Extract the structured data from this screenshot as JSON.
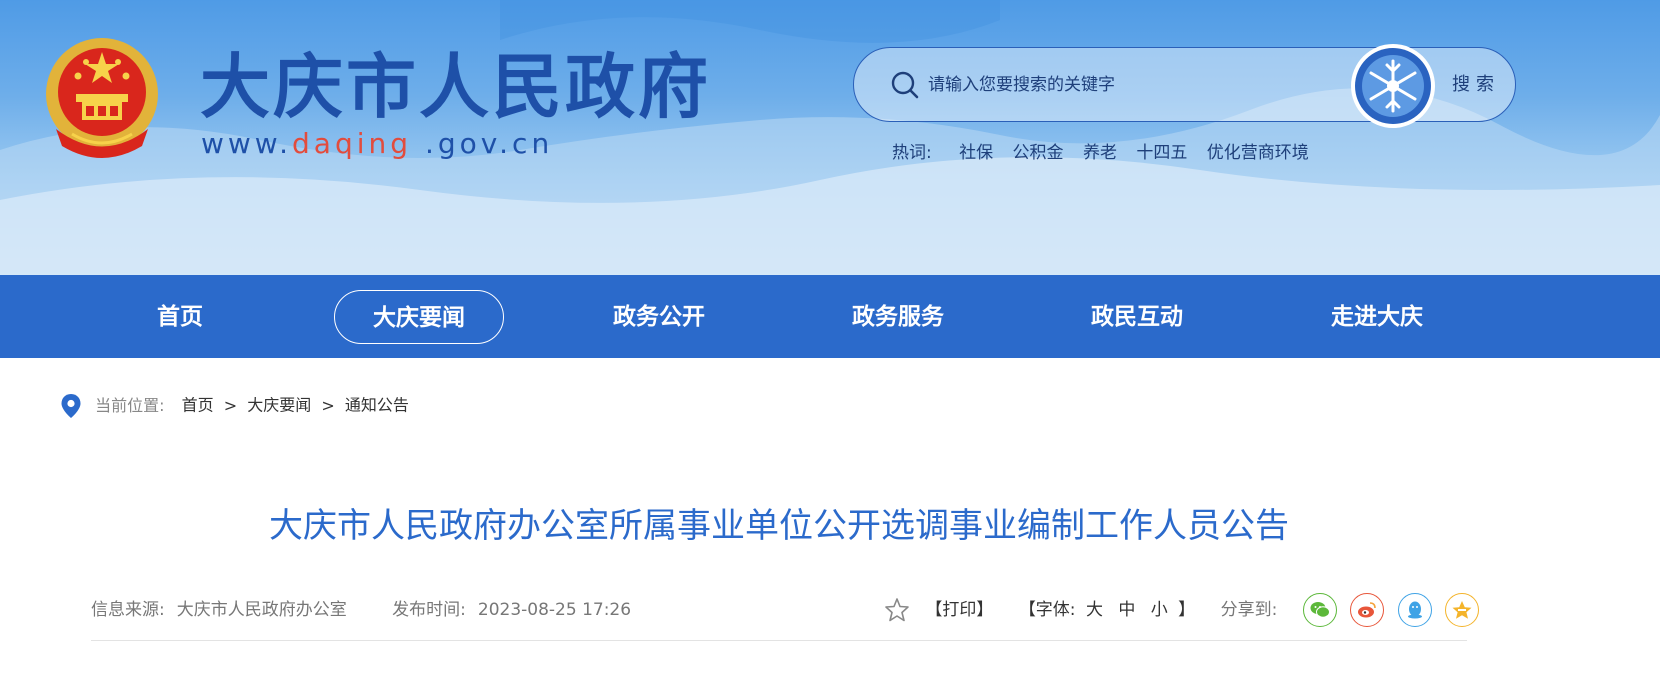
{
  "header": {
    "title": "大庆市人民政府",
    "url_prefix": "www.",
    "url_highlight": "daqing",
    "url_suffix": " .gov.cn"
  },
  "search": {
    "placeholder": "请输入您要搜索的关键字",
    "button_label": "搜索"
  },
  "hot_words": {
    "label": "热词:",
    "items": [
      "社保",
      "公积金",
      "养老",
      "十四五",
      "优化营商环境"
    ]
  },
  "nav": {
    "items": [
      "首页",
      "大庆要闻",
      "政务公开",
      "政务服务",
      "政民互动",
      "走进大庆"
    ],
    "active": "大庆要闻"
  },
  "breadcrumb": {
    "label": "当前位置:",
    "items": [
      "首页",
      "大庆要闻",
      "通知公告"
    ],
    "separator": ">"
  },
  "article": {
    "title": "大庆市人民政府办公室所属事业单位公开选调事业编制工作人员公告",
    "source_label": "信息来源:",
    "source": "大庆市人民政府办公室",
    "time_label": "发布时间:",
    "time": "2023-08-25 17:26"
  },
  "tools": {
    "print": "【打印】",
    "font_label": "【字体:",
    "font_large": "大",
    "font_medium": "中",
    "font_small": "小",
    "font_close": "】",
    "share_label": "分享到:"
  },
  "share": [
    {
      "icon": "wechat-icon",
      "color": "#5cb83a"
    },
    {
      "icon": "weibo-icon",
      "color": "#e8563a"
    },
    {
      "icon": "qq-icon",
      "color": "#3fa3e6"
    },
    {
      "icon": "qzone-icon",
      "color": "#f4b42b"
    }
  ],
  "colors": {
    "brand_blue": "#2b6acb",
    "title_blue": "#1e50a8",
    "url_red": "#e24c3d"
  }
}
